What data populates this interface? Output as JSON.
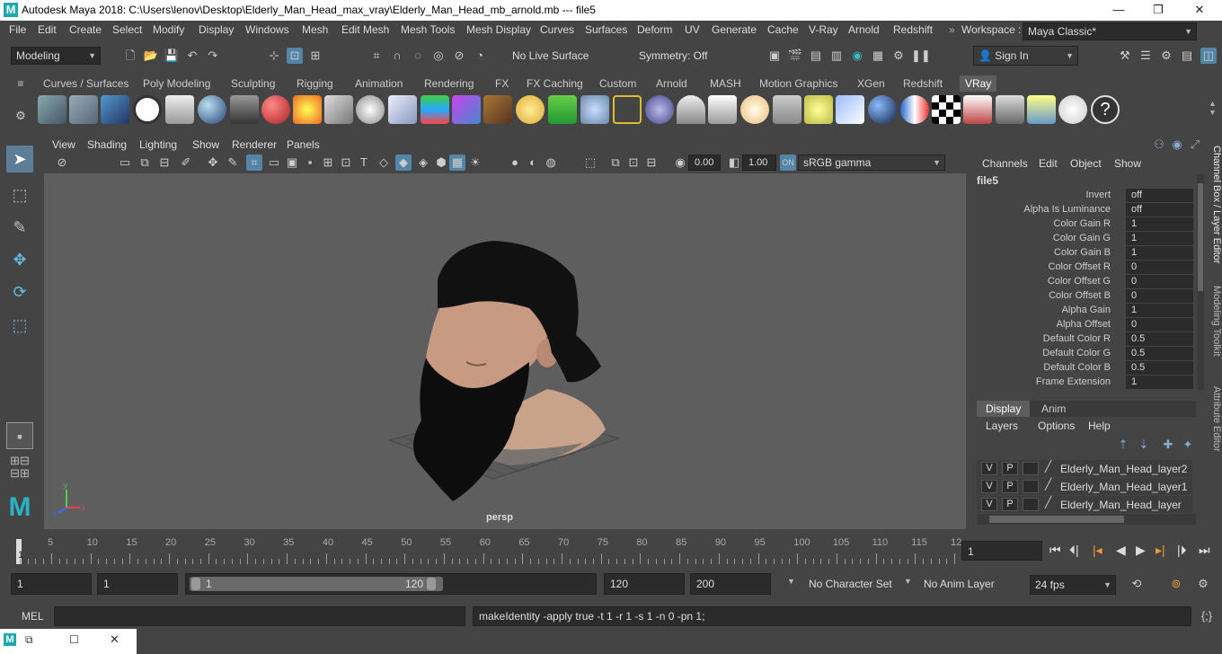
{
  "window": {
    "title": "Autodesk Maya 2018: C:\\Users\\lenov\\Desktop\\Elderly_Man_Head_max_vray\\Elderly_Man_Head_mb_arnold.mb   ---   file5",
    "minimize": "—",
    "maximize": "❐",
    "close": "✕"
  },
  "menubar": {
    "items": [
      "File",
      "Edit",
      "Create",
      "Select",
      "Modify",
      "Display",
      "Windows",
      "Mesh",
      "Edit Mesh",
      "Mesh Tools",
      "Mesh Display",
      "Curves",
      "Surfaces",
      "Deform",
      "UV",
      "Generate",
      "Cache",
      "V-Ray",
      "Arnold",
      "Redshift"
    ],
    "workspace_label": "Workspace :",
    "workspace_value": "Maya Classic*"
  },
  "statusline": {
    "mode": "Modeling",
    "live_surface": "No Live Surface",
    "symmetry": "Symmetry: Off",
    "sign_in": "Sign In"
  },
  "shelf": {
    "tabs": [
      "Curves / Surfaces",
      "Poly Modeling",
      "Sculpting",
      "Rigging",
      "Animation",
      "Rendering",
      "FX",
      "FX Caching",
      "Custom",
      "Arnold",
      "MASH",
      "Motion Graphics",
      "XGen",
      "Redshift",
      "VRay"
    ],
    "active_tab": "VRay"
  },
  "viewport": {
    "menus": [
      "View",
      "Shading",
      "Lighting",
      "Show",
      "Renderer",
      "Panels"
    ],
    "exposure": "0.00",
    "gamma": "1.00",
    "color_space": "sRGB gamma",
    "camera_label": "persp"
  },
  "channel_box": {
    "menus": [
      "Channels",
      "Edit",
      "Object",
      "Show"
    ],
    "node_name": "file5",
    "attributes": [
      {
        "name": "Invert",
        "value": "off"
      },
      {
        "name": "Alpha Is Luminance",
        "value": "off"
      },
      {
        "name": "Color Gain R",
        "value": "1"
      },
      {
        "name": "Color Gain G",
        "value": "1"
      },
      {
        "name": "Color Gain B",
        "value": "1"
      },
      {
        "name": "Color Offset R",
        "value": "0"
      },
      {
        "name": "Color Offset G",
        "value": "0"
      },
      {
        "name": "Color Offset B",
        "value": "0"
      },
      {
        "name": "Alpha Gain",
        "value": "1"
      },
      {
        "name": "Alpha Offset",
        "value": "0"
      },
      {
        "name": "Default Color R",
        "value": "0.5"
      },
      {
        "name": "Default Color G",
        "value": "0.5"
      },
      {
        "name": "Default Color B",
        "value": "0.5"
      },
      {
        "name": "Frame Extension",
        "value": "1"
      }
    ],
    "side_tabs": [
      "Channel Box / Layer Editor",
      "Modeling Toolkit",
      "Attribute Editor"
    ]
  },
  "layer_editor": {
    "tabs": [
      "Display",
      "Anim"
    ],
    "menus": [
      "Layers",
      "Options",
      "Help"
    ],
    "layers": [
      {
        "v": "V",
        "p": "P",
        "name": "Elderly_Man_Head_layer2"
      },
      {
        "v": "V",
        "p": "P",
        "name": "Elderly_Man_Head_layer1"
      },
      {
        "v": "V",
        "p": "P",
        "name": "Elderly_Man_Head_layer"
      }
    ]
  },
  "timeline": {
    "ticks": [
      "1",
      "5",
      "10",
      "15",
      "20",
      "25",
      "30",
      "35",
      "40",
      "45",
      "50",
      "55",
      "60",
      "65",
      "70",
      "75",
      "80",
      "85",
      "90",
      "95",
      "100",
      "105",
      "110",
      "115",
      "12"
    ],
    "current_frame": "1"
  },
  "range": {
    "start": "1",
    "playback_start": "1",
    "slider_start": "1",
    "slider_end": "120",
    "playback_end": "120",
    "end": "200",
    "character_set": "No Character Set",
    "anim_layer": "No Anim Layer",
    "fps": "24 fps"
  },
  "command": {
    "language": "MEL",
    "feedback": "makeIdentity -apply true -t 1 -r 1 -s 1 -n 0 -pn 1;"
  }
}
